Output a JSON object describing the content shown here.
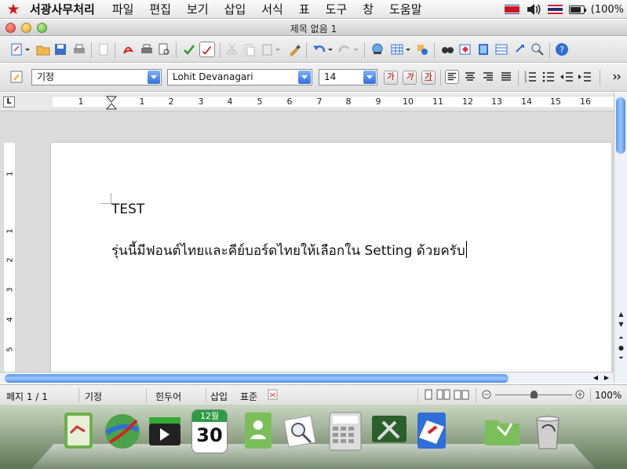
{
  "menubar": {
    "app_name": "서광사무처리",
    "items": [
      "파일",
      "편집",
      "보기",
      "삽입",
      "서식",
      "표",
      "도구",
      "창",
      "도움말"
    ],
    "battery_text": "(100%"
  },
  "window": {
    "title": "제목 없음 1"
  },
  "formatting": {
    "paragraph_style": "기정",
    "font_name": "Lohit Devanagari",
    "font_size": "14",
    "bold_label": "가",
    "italic_label": "가",
    "underline_label": "가"
  },
  "ruler": {
    "numbers": [
      "1",
      "1",
      "2",
      "3",
      "4",
      "5",
      "6",
      "7",
      "8",
      "9",
      "10",
      "11",
      "12",
      "13",
      "14",
      "15",
      "16"
    ],
    "vertical_numbers": [
      "1",
      "1",
      "2",
      "3",
      "4",
      "5"
    ]
  },
  "document": {
    "line1": "TEST",
    "line2": "รุ่นนี้มีฟอนต์ไทยและคีย์บอร์ดไทยให้เลือกใน Setting ด้วยครับ"
  },
  "statusbar": {
    "page": "페지  1 / 1",
    "style": "기정",
    "language": "힌두어",
    "insert_mode": "삽입",
    "selection_mode": "표준",
    "zoom": "100%"
  },
  "dock": {
    "calendar_month": "12월",
    "calendar_day": "30"
  },
  "colors": {
    "accent_blue": "#2f6fd8",
    "star_red": "#d3141b"
  }
}
